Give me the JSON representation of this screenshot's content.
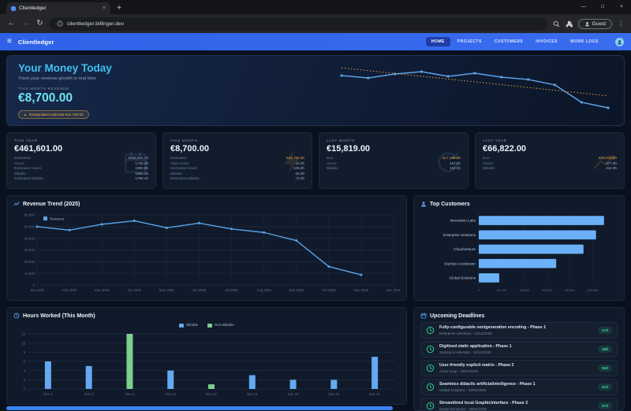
{
  "browser": {
    "tab_title": "Clientledger",
    "new_tab_button": "+",
    "url": "clientledger.billinger.dev",
    "guest_label": "Guest"
  },
  "app": {
    "brand": "Clientledger",
    "nav": [
      {
        "label": "HOME",
        "active": true
      },
      {
        "label": "PROJECTS",
        "active": false
      },
      {
        "label": "CUSTOMERS",
        "active": false
      },
      {
        "label": "INVOICES",
        "active": false
      },
      {
        "label": "WORK LOGS",
        "active": false
      }
    ]
  },
  "hero": {
    "title": "Your Money Today",
    "subtitle": "Track your revenue growth in real time",
    "revenue_label": "THIS MONTH REVENUE",
    "revenue_value": "€8,700.00",
    "badge_arrow": "▲",
    "estimate_badge": "Extrapolated estimate €21,750.00"
  },
  "stat_cards": [
    {
      "label": "THIS YEAR",
      "value": "€461,601.00",
      "icon": "calendar-icon",
      "icon_color": "rgba(130,165,225,0.13)",
      "rows": [
        {
          "k": "Estimated:",
          "v": "€465,504.73",
          "amber": false
        },
        {
          "k": "Hours:",
          "v": "1730.0h"
        },
        {
          "k": "Estimated Hours:",
          "v": "1983.8h"
        },
        {
          "k": "Billable:",
          "v": "1560.0h"
        },
        {
          "k": "Estimated Billable:",
          "v": "1708.4h"
        }
      ]
    },
    {
      "label": "THIS MONTH",
      "value": "€8,700.00",
      "icon": "bolt-icon",
      "icon_color": "rgba(232,163,60,0.13)",
      "rows": [
        {
          "k": "Estimated:",
          "v": "€21,750.00",
          "amber": true
        },
        {
          "k": "Total Hours:",
          "v": "42.0h"
        },
        {
          "k": "Estimated Hours:",
          "v": "105.0h"
        },
        {
          "k": "Billable:",
          "v": "29.0h"
        },
        {
          "k": "Estimated Billable:",
          "v": "72.5h"
        }
      ]
    },
    {
      "label": "LAST MONTH",
      "value": "€15,819.00",
      "icon": "refresh-icon",
      "icon_color": "rgba(130,165,225,0.13)",
      "rows": [
        {
          "k": "Due:",
          "v": "€17,199.00",
          "amber": true
        },
        {
          "k": "Hours:",
          "v": "157.0h"
        },
        {
          "k": "Billable:",
          "v": "132.0h"
        }
      ]
    },
    {
      "label": "LAST YEAR",
      "value": "€66,822.00",
      "icon": "trend-up-icon",
      "icon_color": "rgba(232,163,60,0.13)",
      "rows": [
        {
          "k": "Due:",
          "v": "€59,815.00",
          "amber": true
        },
        {
          "k": "Hours:",
          "v": "377.0h"
        },
        {
          "k": "Billable:",
          "v": "324.0h"
        }
      ]
    }
  ],
  "panels": {
    "revenue": {
      "title": "Revenue Trend (2025)",
      "icon": "line-chart-icon"
    },
    "customers": {
      "title": "Top Customers",
      "icon": "customers-icon"
    },
    "hours": {
      "title": "Hours Worked (This Month)",
      "icon": "clock-icon",
      "legend": [
        {
          "label": "Billable",
          "color": "#64a9f0"
        },
        {
          "label": "Non-Billable",
          "color": "#7ccf8f"
        }
      ]
    },
    "deadlines": {
      "title": "Upcoming Deadlines",
      "icon": "calendar-icon"
    }
  },
  "deadlines": [
    {
      "title": "Fully-configurable nextgeneration encoding - Phase 1",
      "meta": "Enterprise Solutions - 10/12/2025",
      "days": "17d"
    },
    {
      "title": "Digitized static application - Phase 1",
      "meta": "StartUp Accelerator - 21/12/2025",
      "days": "28d"
    },
    {
      "title": "User-friendly explicit matrix - Phase 2",
      "meta": "Acme Corp - 18/01/2026",
      "days": "56d"
    },
    {
      "title": "Seamless didactic artificialintelligence - Phase 1",
      "meta": "Global Solutions - 23/01/2026",
      "days": "61d"
    },
    {
      "title": "Streamlined local GraphicInterface - Phase 2",
      "meta": "Digital Dynamics - 29/01/2026",
      "days": "67d"
    }
  ],
  "colors": {
    "accent_blue": "#3a6cf0",
    "line_blue": "#5ba3e8",
    "bar_blue": "#6ab1f7",
    "green": "#7ccf8f",
    "amber": "#e8a33c",
    "cyan": "#6fe3f2",
    "badge_green": "#3ddc97"
  },
  "chart_data": [
    {
      "id": "hero_spark",
      "type": "line",
      "x": [
        "Jan",
        "Feb",
        "Mar",
        "Apr",
        "May",
        "Jun",
        "Jul",
        "Aug",
        "Sep",
        "Oct",
        "Nov"
      ],
      "values": [
        50000,
        47000,
        52000,
        55000,
        49000,
        53000,
        48000,
        45000,
        38082,
        15819,
        8700
      ],
      "line_color": "#5ba3e8",
      "trend_color": "#e8a33c",
      "trendline": true,
      "grid": false
    },
    {
      "id": "revenue_trend",
      "type": "line",
      "title": "Revenue Trend (2025)",
      "categories": [
        "Jan 2025",
        "Feb 2025",
        "Mar 2025",
        "Apr 2025",
        "May 2025",
        "Jun 2025",
        "Jul 2025",
        "Aug 2025",
        "Sep 2025",
        "Oct 2025",
        "Nov 2025",
        "Dec 2025"
      ],
      "values": [
        50000,
        47000,
        52000,
        55000,
        49000,
        53000,
        48000,
        45000,
        38082,
        15819,
        8700,
        null
      ],
      "legend": [
        "Revenue"
      ],
      "color": "#5ba3e8",
      "ylim": [
        0,
        60000
      ],
      "yticks": [
        0,
        10000,
        20000,
        30000,
        40000,
        50000,
        60000
      ],
      "xlabel": "",
      "ylabel": "",
      "grid": true,
      "legend_position": "top-left"
    },
    {
      "id": "top_customers",
      "type": "bar",
      "orientation": "horizontal",
      "title": "Top Customers",
      "categories": [
        "Innovation Labs",
        "Enterprise Solutions",
        "CloudVenture",
        "StartUp Accelerator",
        "Global Solutions"
      ],
      "values": [
        110000,
        103000,
        92000,
        68000,
        18000
      ],
      "color": "#6ab1f7",
      "xlim": [
        0,
        115000
      ],
      "xticks": [
        "0",
        "20,000",
        "40,000",
        "60,000",
        "80,000",
        "100,000"
      ],
      "grid": true
    },
    {
      "id": "hours_worked",
      "type": "bar",
      "title": "Hours Worked (This Month)",
      "categories": [
        "Nov 3",
        "Nov 4",
        "Nov 6",
        "Nov 10",
        "Nov 12",
        "Nov 14",
        "Nov 18",
        "Nov 20",
        "Nov 21"
      ],
      "series": [
        {
          "name": "Billable",
          "color": "#64a9f0",
          "values": [
            6,
            5,
            0,
            4,
            0,
            3,
            2,
            2,
            7
          ]
        },
        {
          "name": "Non-Billable",
          "color": "#7ccf8f",
          "values": [
            0,
            0,
            12,
            0,
            1,
            0,
            0,
            0,
            0
          ]
        }
      ],
      "ylim": [
        0,
        12
      ],
      "yticks": [
        0,
        2,
        4,
        6,
        8,
        10,
        12
      ],
      "grid": true,
      "legend_position": "top-center"
    }
  ]
}
